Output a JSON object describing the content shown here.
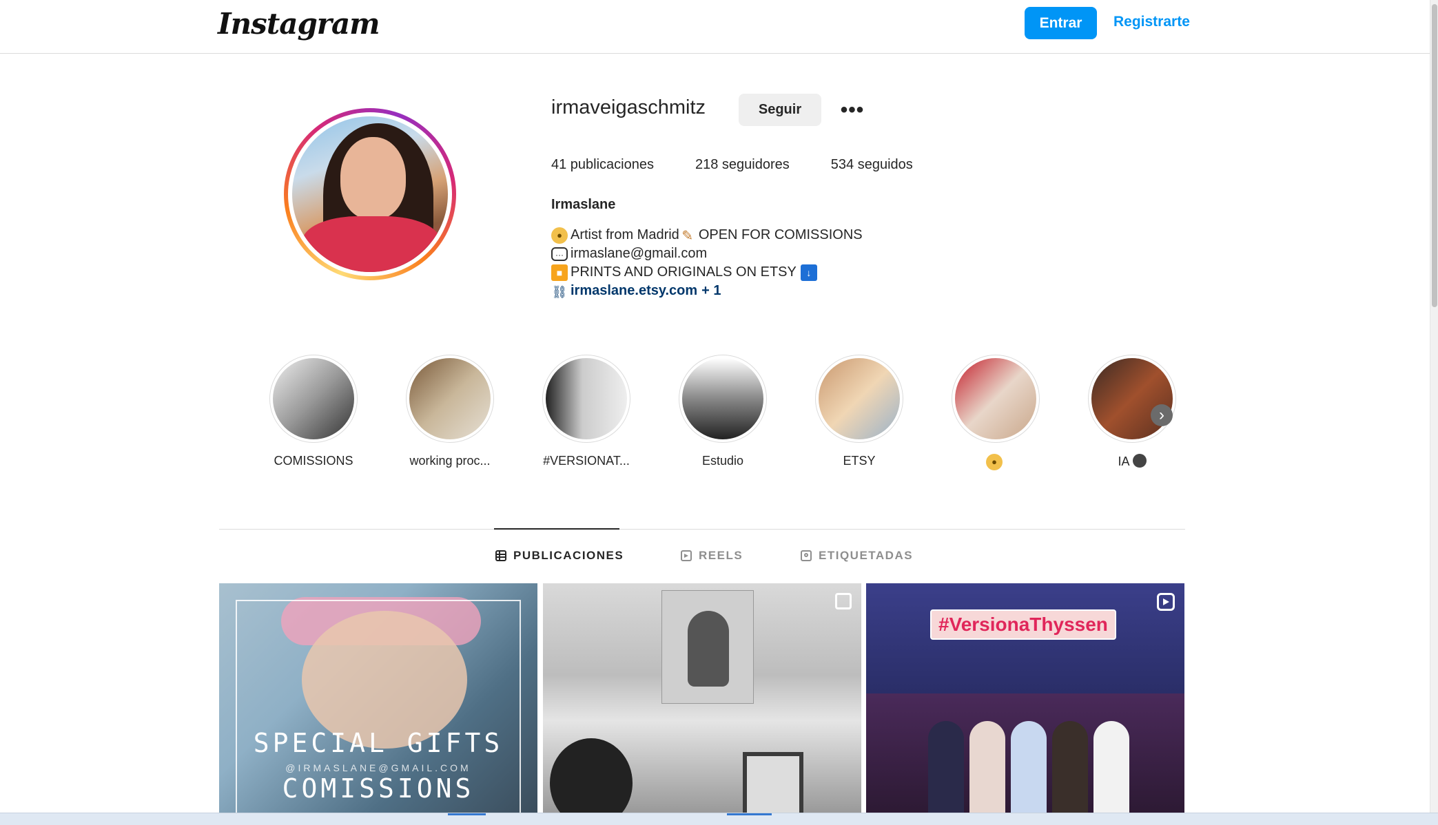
{
  "nav": {
    "logo": "Instagram",
    "login_label": "Entrar",
    "register_label": "Registrarte"
  },
  "profile": {
    "username": "irmaveigaschmitz",
    "follow_label": "Seguir",
    "more_icon": "•••",
    "stats": {
      "posts": "41 publicaciones",
      "followers": "218 seguidores",
      "following": "534 seguidos"
    },
    "full_name": "Irmaslane",
    "bio": {
      "line1_a": "Artist from Madrid",
      "line1_b": "OPEN FOR COMISSIONS",
      "line2": "irmaslane@gmail.com",
      "line3": "PRINTS AND ORIGINALS ON ETSY",
      "link": "irmaslane.etsy.com",
      "link_more": "+ 1"
    }
  },
  "highlights": [
    {
      "label": "COMISSIONS",
      "icon": "palette"
    },
    {
      "label": "working proc...",
      "icon": ""
    },
    {
      "label": "#VERSIONAT...",
      "icon": ""
    },
    {
      "label": "Estudio",
      "icon": ""
    },
    {
      "label": "ETSY",
      "icon": ""
    },
    {
      "label": "",
      "icon": "palette-icon"
    },
    {
      "label": "IA",
      "icon": "devil-icon"
    }
  ],
  "tabs": {
    "posts": "PUBLICACIONES",
    "reels": "REELS",
    "tagged": "ETIQUETADAS"
  },
  "posts": [
    {
      "title": "SPECIAL GIFTS",
      "subtitle": "@IRMASLANE@GMAIL.COM",
      "title2": "COMISSIONS"
    },
    {
      "type": "multi"
    },
    {
      "tag": "#VersionaThyssen",
      "type": "reel"
    }
  ],
  "colors": {
    "accent": "#0095f6",
    "link": "#00376b",
    "text": "#262626",
    "muted": "#8e8e8e"
  }
}
